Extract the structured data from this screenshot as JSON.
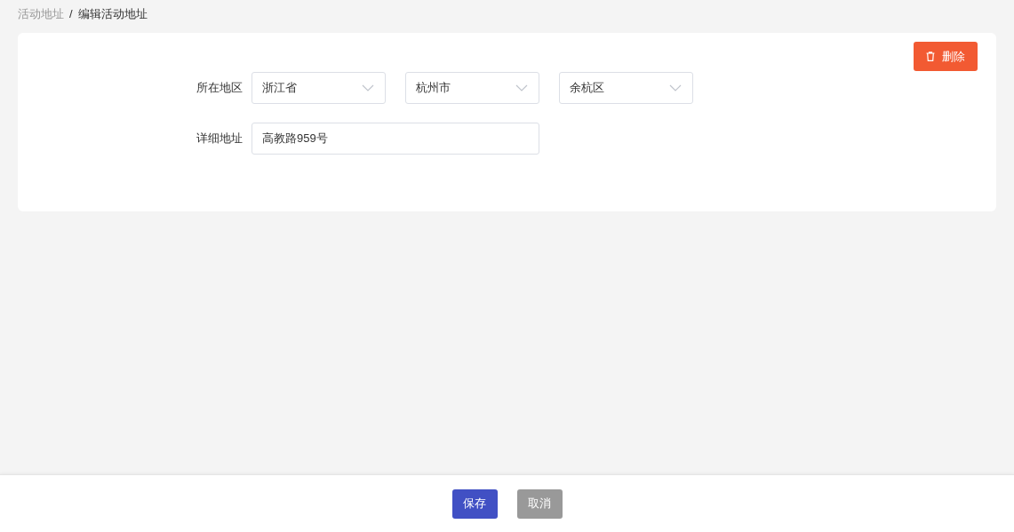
{
  "breadcrumb": [
    {
      "label": "活动地址",
      "current": false
    },
    {
      "label": "编辑活动地址",
      "current": true
    }
  ],
  "breadcrumb_separator": "/",
  "delete_button": {
    "label": "删除"
  },
  "form": {
    "region": {
      "label": "所在地区",
      "selects": [
        {
          "value": "浙江省"
        },
        {
          "value": "杭州市"
        },
        {
          "value": "余杭区"
        }
      ]
    },
    "address": {
      "label": "详细地址",
      "value": "高教路959号"
    }
  },
  "footer_buttons": [
    {
      "label": "保存",
      "kind": "primary"
    },
    {
      "label": "取消",
      "kind": "secondary"
    }
  ]
}
